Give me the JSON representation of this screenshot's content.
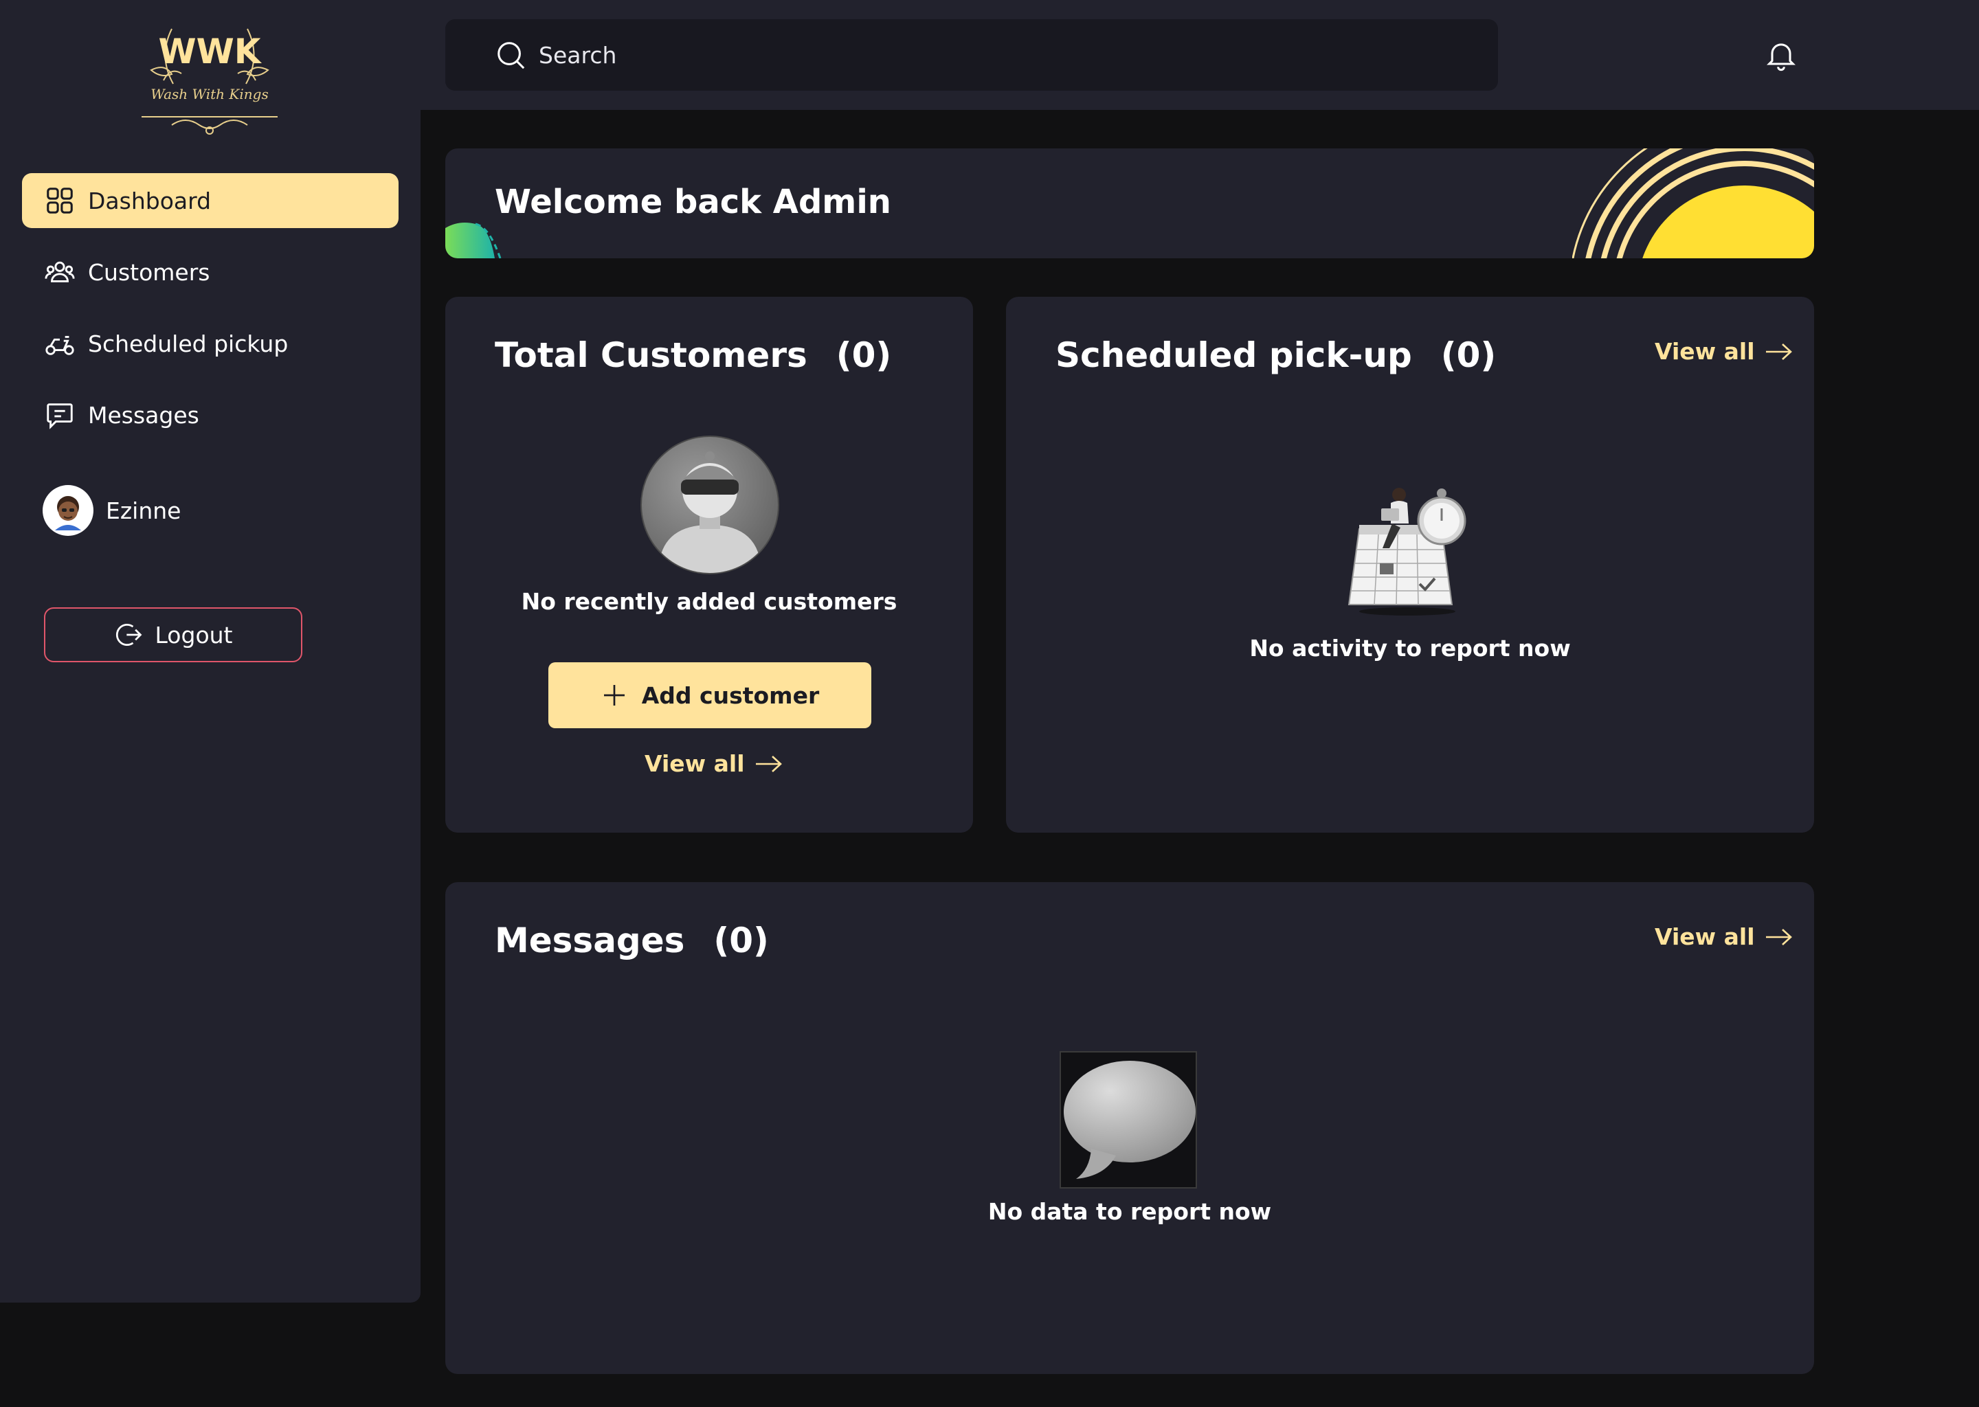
{
  "brand": {
    "logo_mark": "WWK",
    "logo_text": "Wash With Kings"
  },
  "sidebar": {
    "items": [
      {
        "label": "Dashboard",
        "icon": "grid-icon",
        "active": true
      },
      {
        "label": "Customers",
        "icon": "users-icon",
        "active": false
      },
      {
        "label": "Scheduled pickup",
        "icon": "scooter-icon",
        "active": false
      },
      {
        "label": "Messages",
        "icon": "message-icon",
        "active": false
      }
    ],
    "profile_name": "Ezinne",
    "logout_label": "Logout"
  },
  "search": {
    "placeholder": "Search"
  },
  "welcome": {
    "title": "Welcome back Admin"
  },
  "customers": {
    "title": "Total Customers",
    "count": "(0)",
    "empty_text": "No recently added customers",
    "add_label": "Add customer",
    "view_all": "View all"
  },
  "pickup": {
    "title": "Scheduled pick-up",
    "count": "(0)",
    "view_all": "View all",
    "empty_text": "No activity to report now"
  },
  "messages": {
    "title": "Messages",
    "count": "(0)",
    "view_all": "View all",
    "empty_text": "No data to report now"
  },
  "colors": {
    "accent": "#ffe39c",
    "panel": "#22222d",
    "background": "#111112",
    "logout_border": "#e0566a",
    "sun": "#ffdf33"
  }
}
